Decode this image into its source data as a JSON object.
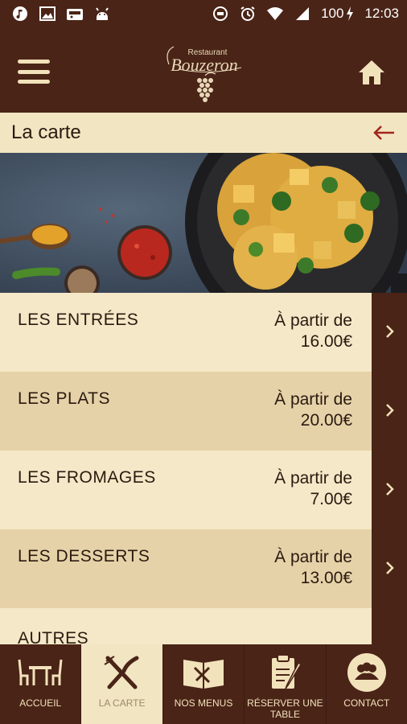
{
  "status_bar": {
    "battery": "100",
    "time": "12:03"
  },
  "app_bar": {
    "logo_small": "Restaurant",
    "logo_name": "Bouzeron"
  },
  "page": {
    "title": "La carte"
  },
  "categories": [
    {
      "name": "LES ENTRÉES",
      "price_prefix": "À partir de",
      "price": "16.00€"
    },
    {
      "name": "LES PLATS",
      "price_prefix": "À partir de",
      "price": "20.00€"
    },
    {
      "name": "LES FROMAGES",
      "price_prefix": "À partir de",
      "price": "7.00€"
    },
    {
      "name": "LES DESSERTS",
      "price_prefix": "À partir de",
      "price": "13.00€"
    },
    {
      "name": "AUTRES"
    }
  ],
  "bottom_nav": [
    {
      "label": "ACCUEIL",
      "icon": "table-chairs-icon"
    },
    {
      "label": "LA CARTE",
      "icon": "fork-knife-icon"
    },
    {
      "label": "NOS MENUS",
      "icon": "open-menu-icon"
    },
    {
      "label": "RÉSERVER UNE TABLE",
      "icon": "reservation-clipboard-icon"
    },
    {
      "label": "CONTACT",
      "icon": "people-icon"
    }
  ],
  "colors": {
    "brand_brown": "#4a2417",
    "cream": "#f5e8c8",
    "cream_dark": "#e6d2a8",
    "accent_red": "#a3271c"
  }
}
